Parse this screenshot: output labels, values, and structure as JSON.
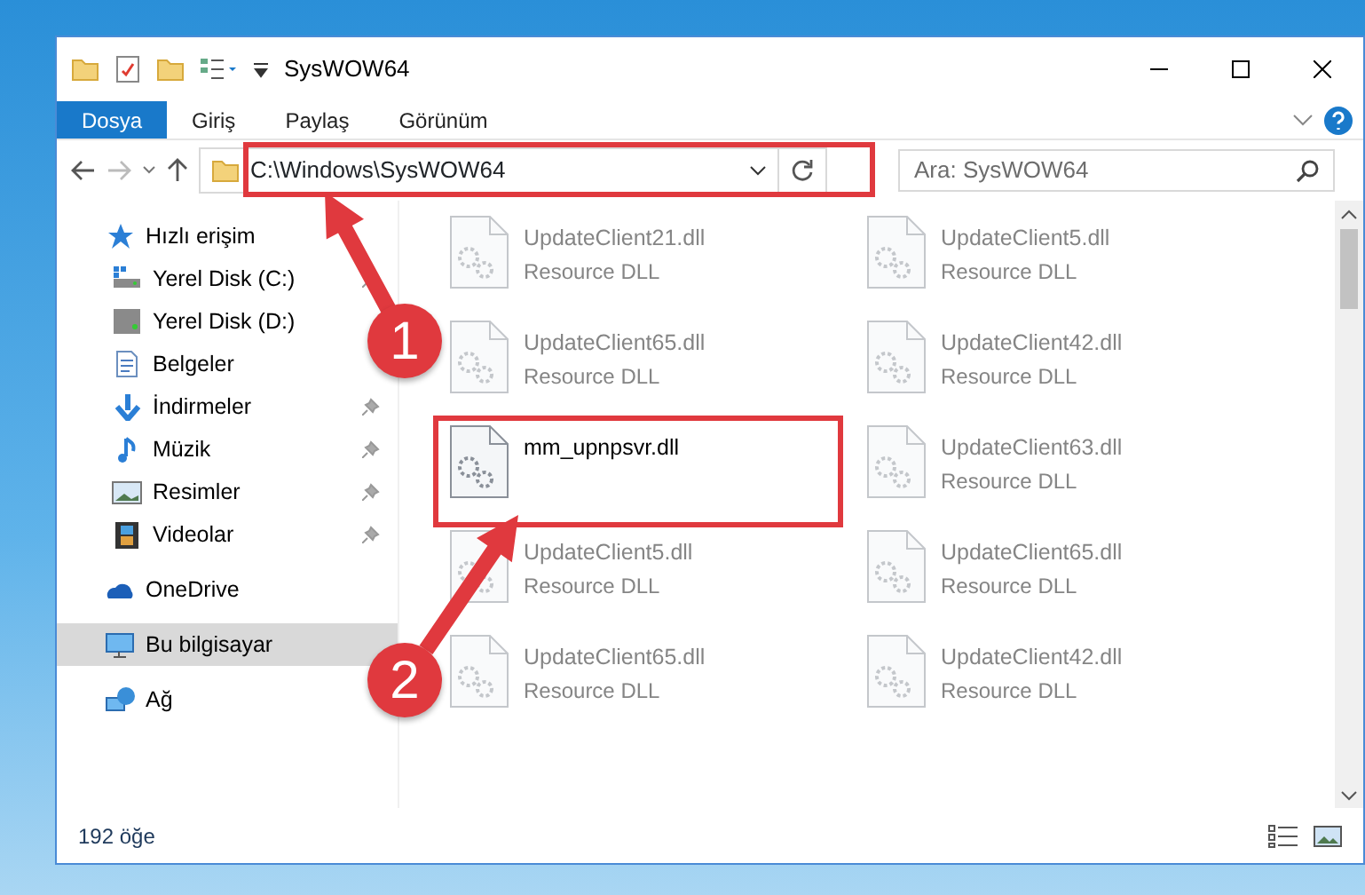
{
  "window": {
    "title": "SysWOW64"
  },
  "ribbon_tabs": [
    {
      "label": "Dosya",
      "selected": true
    },
    {
      "label": "Giriş",
      "selected": false
    },
    {
      "label": "Paylaş",
      "selected": false
    },
    {
      "label": "Görünüm",
      "selected": false
    }
  ],
  "address_bar": {
    "path": "C:\\Windows\\SysWOW64"
  },
  "search": {
    "placeholder": "Ara: SysWOW64"
  },
  "sidebar": {
    "items": [
      {
        "label": "Hızlı erişim",
        "kind": "star",
        "selected": false,
        "children": [
          {
            "label": "Yerel Disk (C:)",
            "kind": "sysdrive",
            "selected": false,
            "pinned": true
          },
          {
            "label": "Yerel Disk (D:)",
            "kind": "drive",
            "selected": false,
            "pinned": false
          },
          {
            "label": "Belgeler",
            "kind": "documents",
            "selected": false,
            "pinned": false
          },
          {
            "label": "İndirmeler",
            "kind": "downloads",
            "selected": false,
            "pinned": true
          },
          {
            "label": "Müzik",
            "kind": "music",
            "selected": false,
            "pinned": true
          },
          {
            "label": "Resimler",
            "kind": "pictures",
            "selected": false,
            "pinned": true
          },
          {
            "label": "Videolar",
            "kind": "videos",
            "selected": false,
            "pinned": true
          }
        ]
      },
      {
        "label": "OneDrive",
        "kind": "cloud",
        "selected": false
      },
      {
        "label": "Bu bilgisayar",
        "kind": "computer",
        "selected": true
      },
      {
        "label": "Ağ",
        "kind": "network",
        "selected": false
      }
    ]
  },
  "files": [
    {
      "name": "UpdateClient21.dll",
      "type": "Resource DLL",
      "blurred": true
    },
    {
      "name": "UpdateClient5.dll",
      "type": "Resource DLL",
      "blurred": true
    },
    {
      "name": "UpdateClient65.dll",
      "type": "Resource DLL",
      "blurred": true
    },
    {
      "name": "UpdateClient42.dll",
      "type": "Resource DLL",
      "blurred": true
    },
    {
      "name": "mm_upnpsvr.dll",
      "blurred": false
    },
    {
      "name": "UpdateClient63.dll",
      "type": "Resource DLL",
      "blurred": true
    },
    {
      "name": "UpdateClient5.dll",
      "type": "Resource DLL",
      "blurred": true
    },
    {
      "name": "UpdateClient65.dll",
      "type": "Resource DLL",
      "blurred": true
    },
    {
      "name": "UpdateClient65.dll",
      "type": "Resource DLL",
      "blurred": true
    },
    {
      "name": "UpdateClient42.dll",
      "type": "Resource DLL",
      "blurred": true
    }
  ],
  "status_bar": {
    "item_count": "192 öğe"
  },
  "annotations": {
    "badges": [
      "1",
      "2"
    ]
  }
}
